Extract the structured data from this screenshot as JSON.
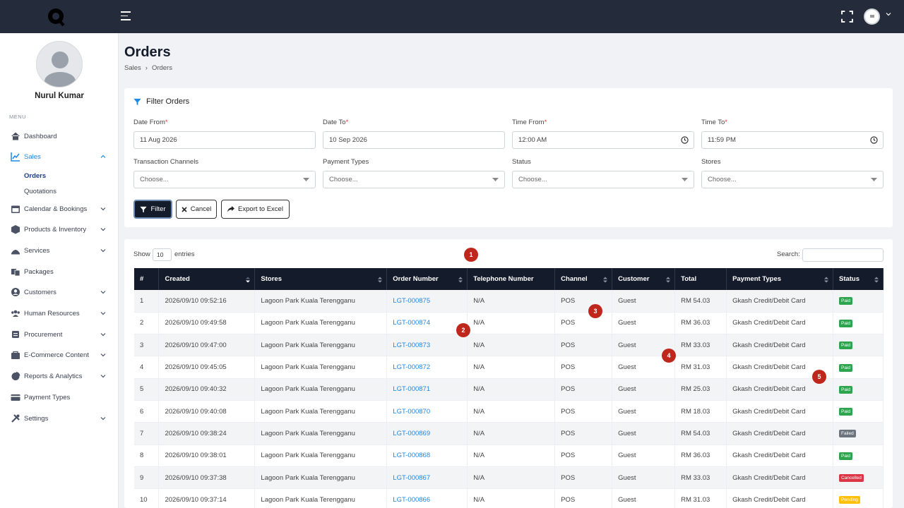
{
  "header": {
    "logo_icon": "q-logo-icon",
    "menu_icon": "hamburger-icon",
    "fullscreen_icon": "expand-icon",
    "user_avatar_icon": "avatar-icon"
  },
  "sidebar": {
    "user_name": "Nurul Kumar",
    "menu_label": "MENU",
    "items": [
      {
        "label": "Dashboard",
        "icon": "home-icon"
      },
      {
        "label": "Sales",
        "icon": "chart-line-icon",
        "active": true
      },
      {
        "label": "Calendar & Bookings",
        "icon": "calendar-icon"
      },
      {
        "label": "Products & Inventory",
        "icon": "box-icon"
      },
      {
        "label": "Services",
        "icon": "services-icon"
      },
      {
        "label": "Packages",
        "icon": "packages-icon"
      },
      {
        "label": "Customers",
        "icon": "user-icon"
      },
      {
        "label": "Human Resources",
        "icon": "users-icon"
      },
      {
        "label": "Procurement",
        "icon": "cart-icon"
      },
      {
        "label": "E-Commerce Content",
        "icon": "ecommerce-icon"
      },
      {
        "label": "Reports & Analytics",
        "icon": "pie-chart-icon"
      },
      {
        "label": "Payment Types",
        "icon": "credit-card-icon"
      },
      {
        "label": "Settings",
        "icon": "tools-icon"
      }
    ],
    "sales_sub": [
      {
        "label": "Orders",
        "active": true
      },
      {
        "label": "Quotations"
      }
    ]
  },
  "page": {
    "title": "Orders",
    "breadcrumb": [
      "Sales",
      "›",
      "Orders"
    ]
  },
  "filter": {
    "title": "Filter Orders",
    "date_from_label": "Date From",
    "date_from_value": "11 Aug 2026",
    "date_to_label": "Date To",
    "date_to_value": "10 Sep 2026",
    "time_from_label": "Time From",
    "time_from_value": "12:00  AM",
    "time_to_label": "Time To",
    "time_to_value": "11:59  PM",
    "required_mark": "*",
    "channels_label": "Transaction Channels",
    "payment_label": "Payment Types",
    "status_label": "Status",
    "stores_label": "Stores",
    "choose_placeholder": "Choose...",
    "filter_button": "Filter",
    "cancel_button": "Cancel",
    "export_button": "Export to Excel"
  },
  "table": {
    "show_label": "Show",
    "show_value": "10",
    "entries_label": "entries",
    "search_label": "Search:",
    "columns": [
      "#",
      "Created",
      "Stores",
      "Order Number",
      "Telephone Number",
      "Channel",
      "Customer",
      "Total",
      "Payment Types",
      "Status"
    ],
    "rows": [
      {
        "n": "1",
        "created": "2026/09/10 09:52:16",
        "store": "Lagoon Park Kuala Terengganu",
        "order": "LGT-000875",
        "tel": "N/A",
        "channel": "POS",
        "customer": "Guest",
        "total": "RM 54.03",
        "payment": "Gkash Credit/Debit Card",
        "status": "Paid"
      },
      {
        "n": "2",
        "created": "2026/09/10 09:49:58",
        "store": "Lagoon Park Kuala Terengganu",
        "order": "LGT-000874",
        "tel": "N/A",
        "channel": "POS",
        "customer": "Guest",
        "total": "RM 36.03",
        "payment": "Gkash Credit/Debit Card",
        "status": "Paid"
      },
      {
        "n": "3",
        "created": "2026/09/10 09:47:00",
        "store": "Lagoon Park Kuala Terengganu",
        "order": "LGT-000873",
        "tel": "N/A",
        "channel": "POS",
        "customer": "Guest",
        "total": "RM 33.03",
        "payment": "Gkash Credit/Debit Card",
        "status": "Paid"
      },
      {
        "n": "4",
        "created": "2026/09/10 09:45:05",
        "store": "Lagoon Park Kuala Terengganu",
        "order": "LGT-000872",
        "tel": "N/A",
        "channel": "POS",
        "customer": "Guest",
        "total": "RM 31.03",
        "payment": "Gkash Credit/Debit Card",
        "status": "Paid"
      },
      {
        "n": "5",
        "created": "2026/09/10 09:40:32",
        "store": "Lagoon Park Kuala Terengganu",
        "order": "LGT-000871",
        "tel": "N/A",
        "channel": "POS",
        "customer": "Guest",
        "total": "RM 25.03",
        "payment": "Gkash Credit/Debit Card",
        "status": "Paid"
      },
      {
        "n": "6",
        "created": "2026/09/10 09:40:08",
        "store": "Lagoon Park Kuala Terengganu",
        "order": "LGT-000870",
        "tel": "N/A",
        "channel": "POS",
        "customer": "Guest",
        "total": "RM 18.03",
        "payment": "Gkash Credit/Debit Card",
        "status": "Paid"
      },
      {
        "n": "7",
        "created": "2026/09/10 09:38:24",
        "store": "Lagoon Park Kuala Terengganu",
        "order": "LGT-000869",
        "tel": "N/A",
        "channel": "POS",
        "customer": "Guest",
        "total": "RM 54.03",
        "payment": "Gkash Credit/Debit Card",
        "status": "Failed"
      },
      {
        "n": "8",
        "created": "2026/09/10 09:38:01",
        "store": "Lagoon Park Kuala Terengganu",
        "order": "LGT-000868",
        "tel": "N/A",
        "channel": "POS",
        "customer": "Guest",
        "total": "RM 36.03",
        "payment": "Gkash Credit/Debit Card",
        "status": "Paid"
      },
      {
        "n": "9",
        "created": "2026/09/10 09:37:38",
        "store": "Lagoon Park Kuala Terengganu",
        "order": "LGT-000867",
        "tel": "N/A",
        "channel": "POS",
        "customer": "Guest",
        "total": "RM 33.03",
        "payment": "Gkash Credit/Debit Card",
        "status": "Cancelled"
      },
      {
        "n": "10",
        "created": "2026/09/10 09:37:14",
        "store": "Lagoon Park Kuala Terengganu",
        "order": "LGT-000866",
        "tel": "N/A",
        "channel": "POS",
        "customer": "Guest",
        "total": "RM 31.03",
        "payment": "Gkash Credit/Debit Card",
        "status": "Pending"
      }
    ]
  },
  "markers": [
    "1",
    "2",
    "3",
    "4",
    "5"
  ],
  "colors": {
    "topbar": "#242b3a",
    "accent": "#1e88e5",
    "header_row": "#141c2b",
    "marker": "#c0271c"
  }
}
